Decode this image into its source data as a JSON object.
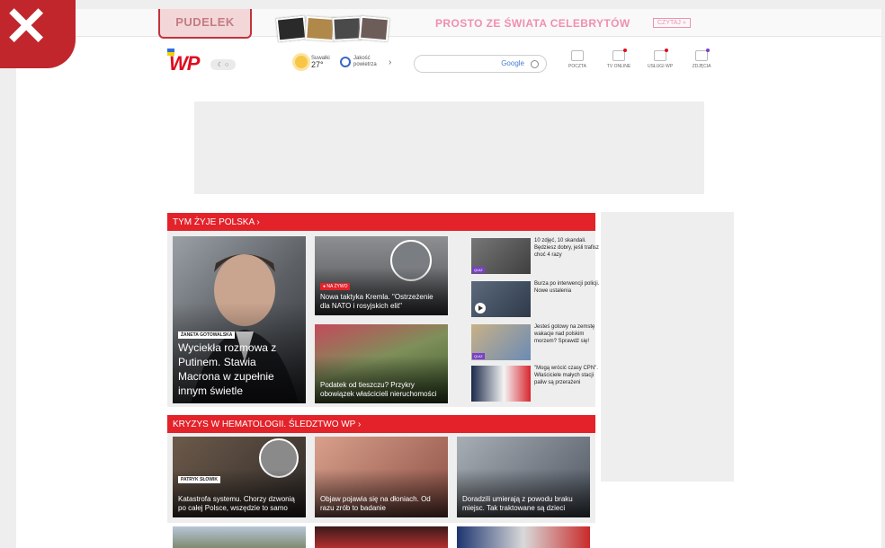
{
  "promo": {
    "logo_text": "PUDELEK",
    "title": "PROSTO ZE ŚWIATA CELEBRYTÓW",
    "cta": "CZYTAJ »"
  },
  "header": {
    "logo": "WP",
    "theme_toggle": "☾ ○",
    "weather": {
      "city": "Suwałki",
      "temp": "27°"
    },
    "air": {
      "label": "Jakość powietrza"
    },
    "search": {
      "placeholder": "",
      "provider": "Google"
    },
    "nav": [
      {
        "label": "POCZTA",
        "icon": "mail-icon"
      },
      {
        "label": "TV ONLINE",
        "icon": "tv-icon"
      },
      {
        "label": "USŁUGI WP",
        "icon": "services-icon"
      },
      {
        "label": "ZDJĘCIA",
        "icon": "photos-icon"
      }
    ]
  },
  "sections": [
    {
      "title": "TYM ŻYJE POLSKA ›",
      "main": {
        "author": "ŻANETA GOTOWALSKA",
        "title": "Wyciekła rozmowa z Putinem. Stawia Macrona w zupełnie innym świetle"
      },
      "mid": [
        {
          "tag": "● NA ŻYWO",
          "title": "Nowa taktyka Kremla. \"Ostrzeżenie dla NATO i rosyjskich elit\""
        },
        {
          "title": "Podatek od tieszczu? Przykry obowiązek właścicieli nieruchomości"
        }
      ],
      "side": [
        {
          "title": "10 zdjęć, 10 skandali. Będziesz dobry, jeśli trafisz choć 4 razy",
          "badge": "QUIZ"
        },
        {
          "title": "Burza po interwencji policji. Nowe ustalenia",
          "badge": ""
        },
        {
          "title": "Jesteś gotowy na zemstę wakacje nad polskim morzem? Sprawdź się!",
          "badge": "QUIZ"
        },
        {
          "title": "\"Mogą wrócić czasy CPN\". Właściciele małych stacji paliw są przerażeni",
          "badge": ""
        }
      ]
    },
    {
      "title": "KRYZYS W HEMATOLOGII. ŚLEDZTWO WP ›",
      "cards": [
        {
          "author": "PATRYK SŁOWIK",
          "title": "Katastrofa systemu. Chorzy dzwonią po całej Polsce, wszędzie to samo"
        },
        {
          "author": "",
          "title": "Objaw pojawia się na dłoniach. Od razu zrób to badanie"
        },
        {
          "author": "",
          "title": "Doradzili umierają z powodu braku miejsc. Tak traktowane są dzieci"
        }
      ]
    }
  ],
  "colors": {
    "brand": "#e3222a",
    "promo_pink": "#f08fb0",
    "close_badge": "#c0262c"
  },
  "close_badge": {
    "icon": "close-icon"
  }
}
